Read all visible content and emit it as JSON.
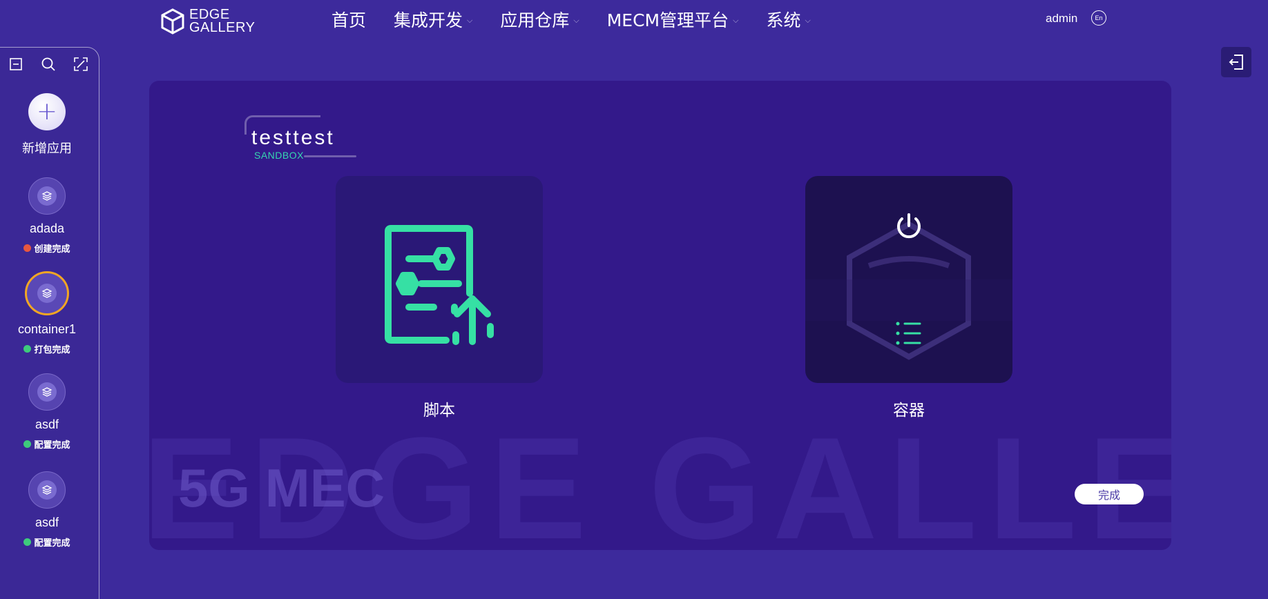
{
  "header": {
    "logo_line1": "EDGE",
    "logo_line2": "GALLERY",
    "nav": [
      {
        "label": "首页",
        "has_dropdown": false
      },
      {
        "label": "集成开发",
        "has_dropdown": true
      },
      {
        "label": "应用仓库",
        "has_dropdown": true
      },
      {
        "label": "MECM管理平台",
        "has_dropdown": true
      },
      {
        "label": "系统",
        "has_dropdown": true
      }
    ],
    "user": "admin",
    "lang": "En"
  },
  "sidebar": {
    "add_label": "新增应用",
    "apps": [
      {
        "name": "adada",
        "status": "创建完成",
        "status_color": "#e8573f",
        "selected": false
      },
      {
        "name": "container1",
        "status": "打包完成",
        "status_color": "#3ecb7c",
        "selected": true
      },
      {
        "name": "asdf",
        "status": "配置完成",
        "status_color": "#3ecb7c",
        "selected": false
      },
      {
        "name": "asdf",
        "status": "配置完成",
        "status_color": "#3ecb7c",
        "selected": false
      }
    ]
  },
  "main": {
    "title": "testtest",
    "subtitle": "SANDBOX",
    "cards": [
      {
        "label": "脚本",
        "icon": "script-upload-icon"
      },
      {
        "label": "容器",
        "icon": "container-power-icon"
      }
    ],
    "watermark": "EDGE GALLERY",
    "slogan": "5G MEC",
    "done_label": "完成"
  },
  "colors": {
    "background": "#3d2a9c",
    "panel": "#33198a",
    "accent_green": "#36e0a4",
    "selected_ring": "#f2a623"
  }
}
